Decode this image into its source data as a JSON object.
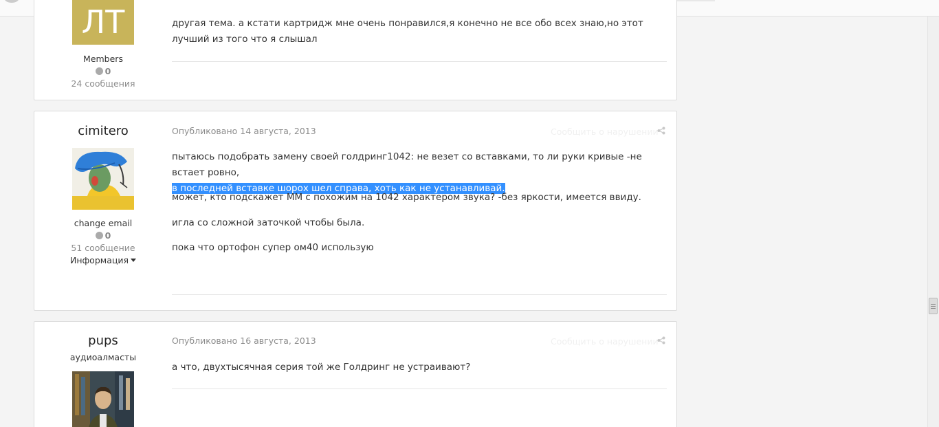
{
  "topbar": {
    "arrow": "⌃"
  },
  "posts": [
    {
      "author": {
        "group": "Members",
        "reputation": "0",
        "posts_count": "24 сообщения",
        "avatar_letters": "ЛТ"
      },
      "paragraphs": [
        "другая тема. а кстати картридж мне очень понравился,я конечно не все  обо всех знаю,но этот лучший из того что я слышал"
      ]
    },
    {
      "author": {
        "name": "cimitero",
        "group": "change email",
        "reputation": "0",
        "posts_count": "51 сообщение",
        "info_label": "Информация"
      },
      "posted": "Опубликовано 14 августа, 2013",
      "report_label": "Сообщить о нарушении",
      "paragraphs": [
        "пытаюсь подобрать замену своей голдринг1042: не везет со вставками, то ли руки кривые -не встает ровно,",
        "в последней вставке шорох шел справа, хоть как не устанавливай.",
        "может, кто подскажет ММ с похожим на 1042 характером звука? -без яркости, имеется ввиду.",
        "игла со сложной заточкой чтобы была.",
        "пока что ортофон супер ом40 использую"
      ]
    },
    {
      "author": {
        "name": "pups",
        "title": "аудиоалмасты"
      },
      "posted": "Опубликовано 16 августа, 2013",
      "report_label": "Сообщить о нарушении",
      "paragraphs": [
        "а что, двухтысячная серия той же Голдринг не устраивают?"
      ]
    }
  ],
  "colors": {
    "highlight": "#3390ff",
    "avatar_gold": "#c8b45a"
  }
}
